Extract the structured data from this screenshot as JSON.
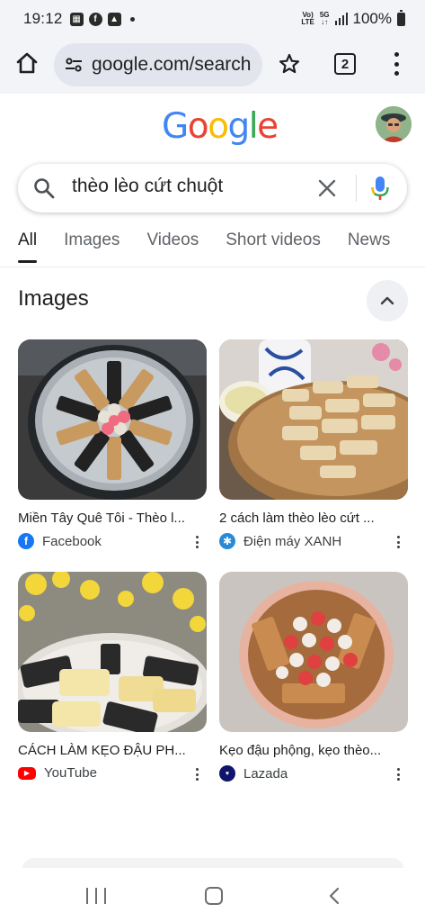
{
  "status_bar": {
    "time": "19:12",
    "battery_percent": "100%",
    "network_tag_top": "Vo)",
    "network_tag_bottom": "LTE",
    "gen_tag": "5G"
  },
  "browser": {
    "url": "google.com/search",
    "tab_count": "2"
  },
  "search": {
    "query": "thèo lèo cứt chuột"
  },
  "tabs": [
    {
      "label": "All",
      "active": true
    },
    {
      "label": "Images"
    },
    {
      "label": "Videos"
    },
    {
      "label": "Short videos"
    },
    {
      "label": "News"
    }
  ],
  "images_section": {
    "title": "Images",
    "results": [
      {
        "caption": "Miền Tây Quê Tôi - Thèo l...",
        "source": "Facebook",
        "favicon_color": "#1877f2"
      },
      {
        "caption": "2 cách làm thèo lèo cứt ...",
        "source": "Điện máy XANH",
        "favicon_color": "#288ad6"
      },
      {
        "caption": "CÁCH LÀM KẸO ĐẬU PH...",
        "source": "YouTube",
        "favicon_color": "#ff0000"
      },
      {
        "caption": "Kẹo đậu phộng, kẹo thèo...",
        "source": "Lazada",
        "favicon_color": "#0f146d"
      }
    ]
  },
  "colors": {
    "google_blue": "#4285F4",
    "google_red": "#EA4335",
    "google_yellow": "#FBBC05",
    "google_green": "#34A853"
  }
}
